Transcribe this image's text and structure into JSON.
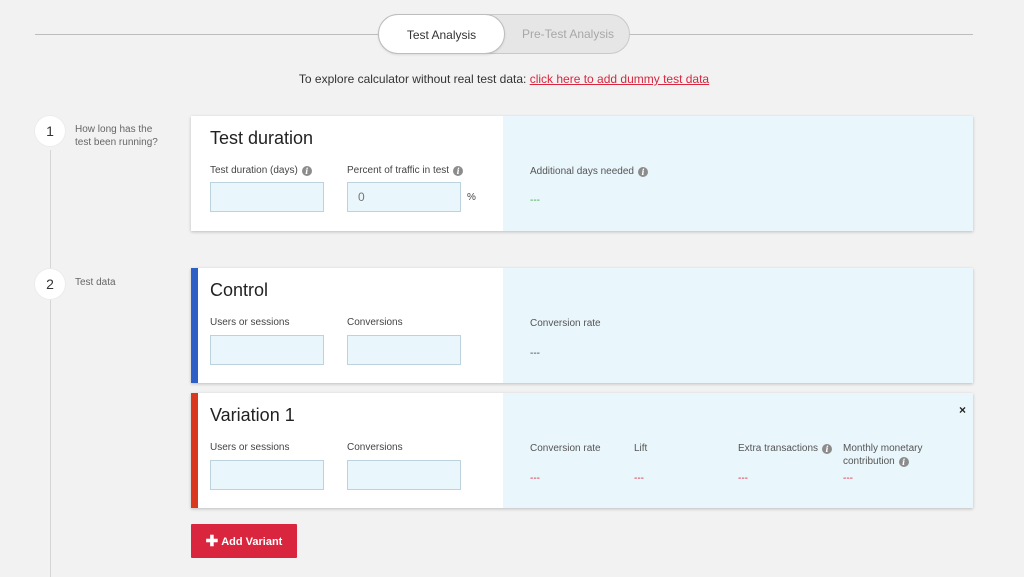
{
  "tabs": {
    "active": "Test Analysis",
    "inactive": "Pre-Test Analysis"
  },
  "explore": {
    "text": "To explore calculator without real test data: ",
    "link": "click here to add dummy test data"
  },
  "steps": [
    {
      "number": "1",
      "label": "How long has the test been running?"
    },
    {
      "number": "2",
      "label": "Test data"
    }
  ],
  "duration_card": {
    "title": "Test duration",
    "field1_label": "Test duration (days)",
    "field2_label": "Percent of traffic in test",
    "field2_placeholder": "0",
    "field2_unit": "%",
    "result_label": "Additional days needed",
    "result_value": "---"
  },
  "control_card": {
    "title": "Control",
    "bar_color": "#2d5fc7",
    "field1_label": "Users or sessions",
    "field2_label": "Conversions",
    "result_label": "Conversion rate",
    "result_value": "---"
  },
  "variation_card": {
    "title": "Variation 1",
    "bar_color": "#d9381e",
    "field1_label": "Users or sessions",
    "field2_label": "Conversions",
    "close_label": "×",
    "results": [
      {
        "label": "Conversion rate",
        "value": "---"
      },
      {
        "label": "Lift",
        "value": "---"
      },
      {
        "label": "Extra transactions",
        "value": "---"
      },
      {
        "label": "Monthly monetary contribution",
        "value": "---"
      }
    ]
  },
  "add_variant": {
    "icon": "plus-icon",
    "label": "Add Variant"
  },
  "colors": {
    "accent": "#d9263e",
    "result_bg": "#e9f6fc",
    "green": "#3caa3c"
  },
  "icons": {
    "info": "info-icon"
  }
}
